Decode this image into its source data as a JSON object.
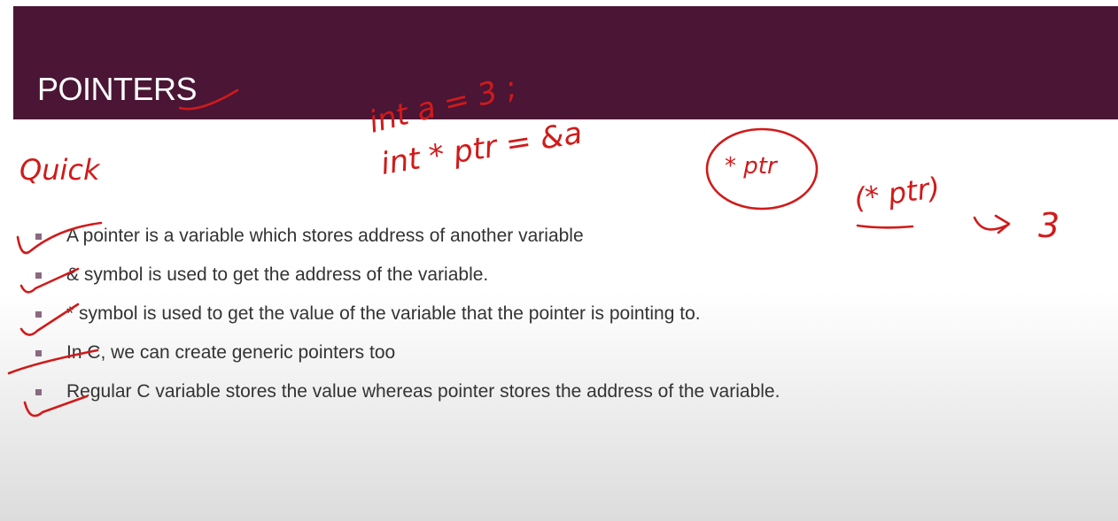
{
  "slide": {
    "title": "POINTERS",
    "bullets": [
      "A pointer is a variable which stores address of another variable",
      "& symbol is used to get the address of the variable.",
      "* symbol is used to get the value of the variable that the pointer is pointing to.",
      "In C, we can create generic pointers too",
      "Regular C variable stores the value whereas pointer stores the address of the variable."
    ]
  },
  "annotations": {
    "quick_note": "Quick",
    "code_line_1": "int a = 3 ;",
    "code_line_2": "int * ptr = &a",
    "circled_expr": "* ptr",
    "deref_expr": "(* ptr)",
    "deref_result": "3"
  },
  "colors": {
    "banner": "#4b1535",
    "title_text": "#ffffff",
    "body_text": "#333333",
    "bullet_marker": "#8a6a80",
    "ink": "#d11a1a"
  }
}
